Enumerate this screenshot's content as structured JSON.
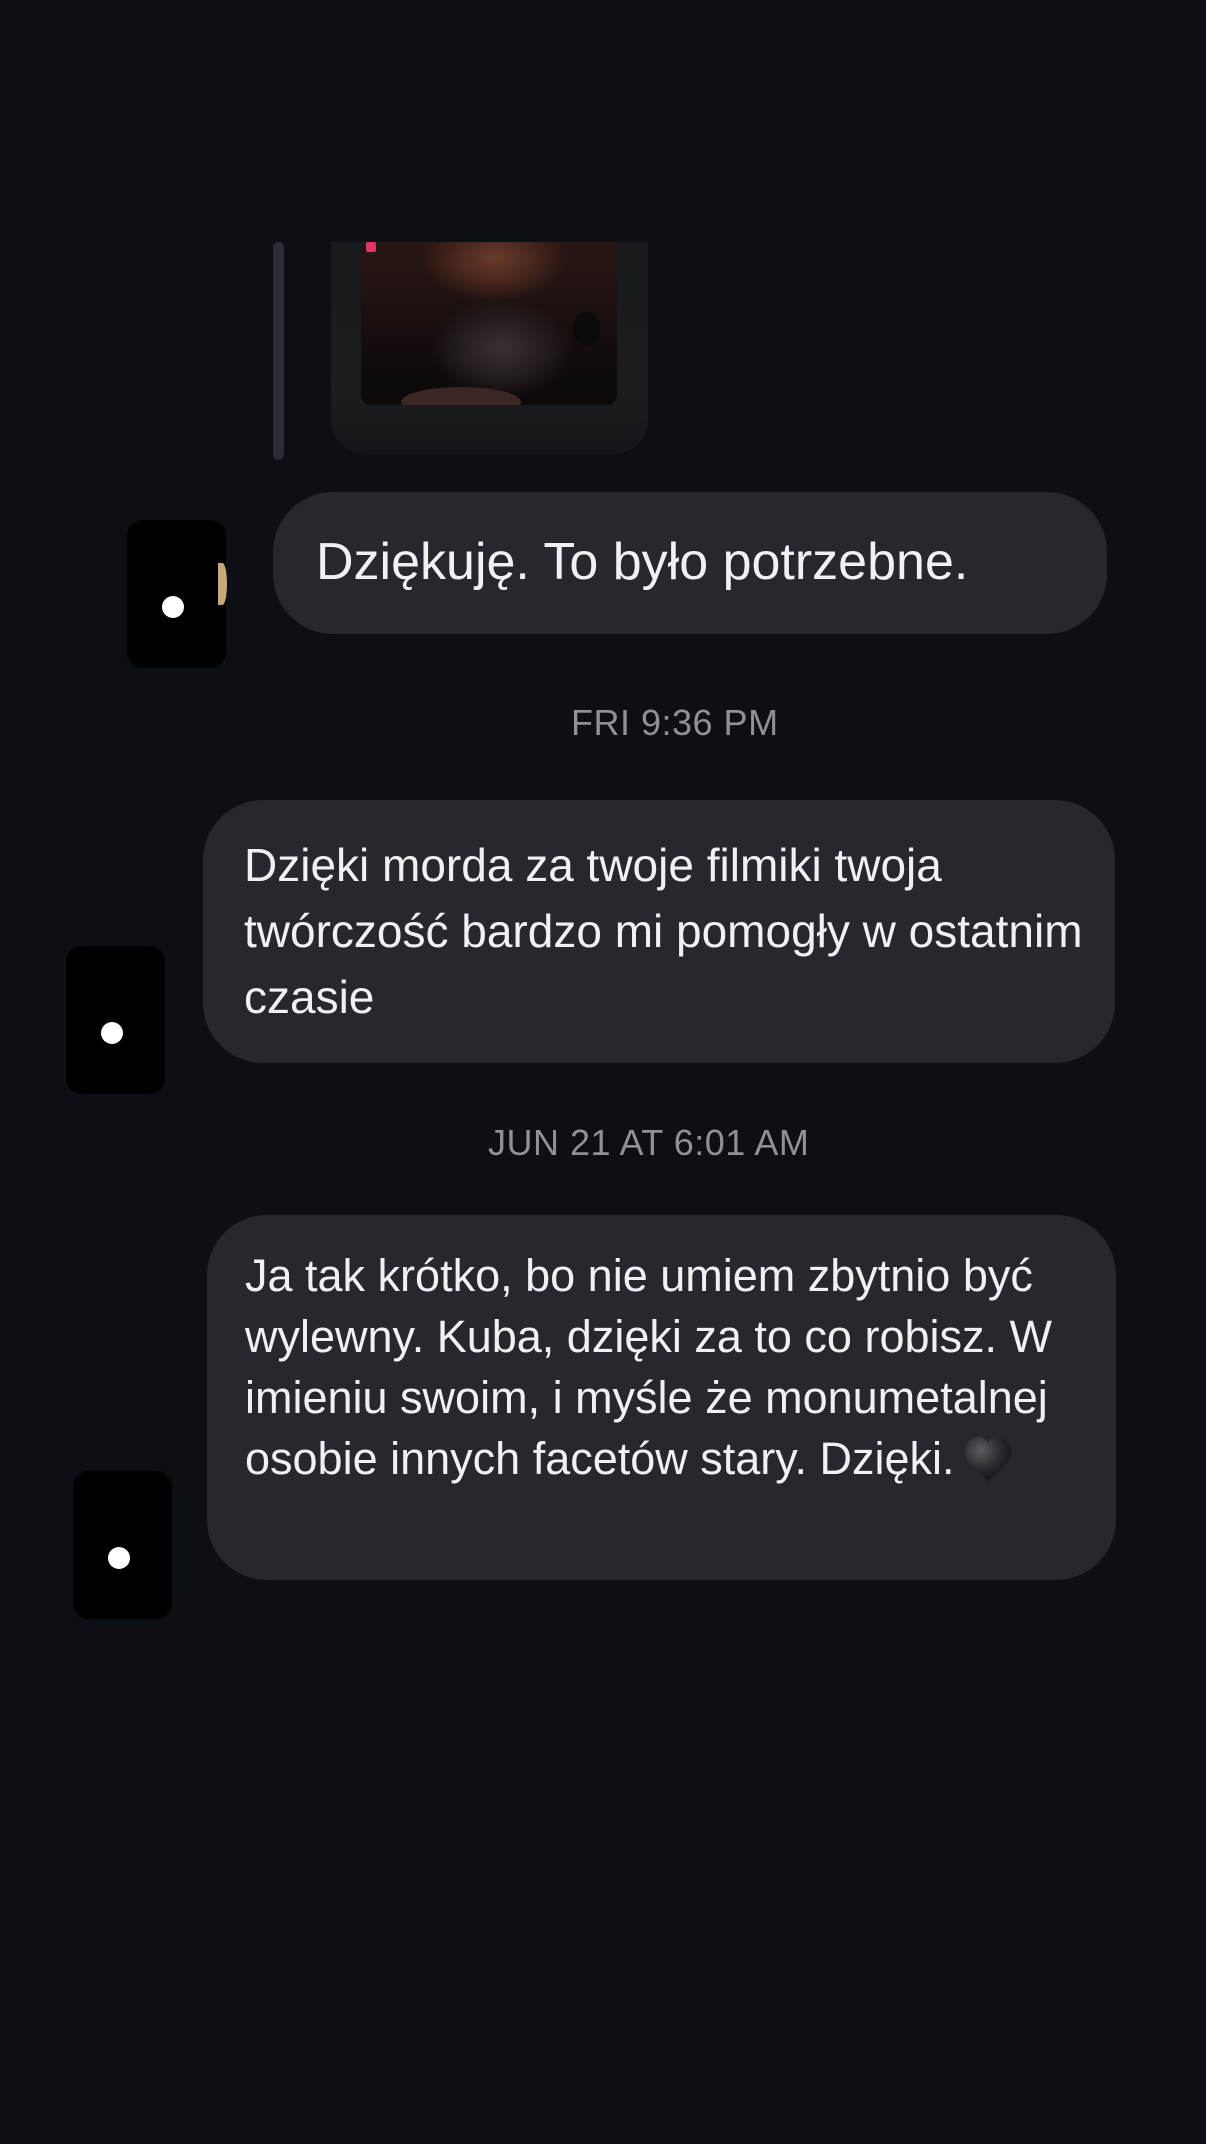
{
  "conversation": {
    "messages": [
      {
        "kind": "media_reply",
        "media_icon": "photo-thumbnail"
      },
      {
        "kind": "text",
        "text": "Dziękuję. To było potrzebne."
      },
      {
        "kind": "text",
        "text": "Dzięki morda za twoje filmiki twoja twórczość bardzo mi pomogły w ostatnim czasie"
      },
      {
        "kind": "text",
        "text": "Ja tak krótko, bo nie umiem zbytnio być wylewny. Kuba, dzięki za to co robisz. W imieniu swoim, i myśle że monumetalnej osobie innych facetów stary. Dzięki.",
        "trailing_emoji": "black-heart-icon"
      }
    ],
    "timestamps": [
      "FRI 9:36 PM",
      "JUN 21 AT 6:01 AM"
    ]
  },
  "colors": {
    "background": "#0c0f13",
    "bubble": "#25282d",
    "bubble_text": "#f0f1f3",
    "timestamp": "#8e9196",
    "avatar": "#000000"
  }
}
